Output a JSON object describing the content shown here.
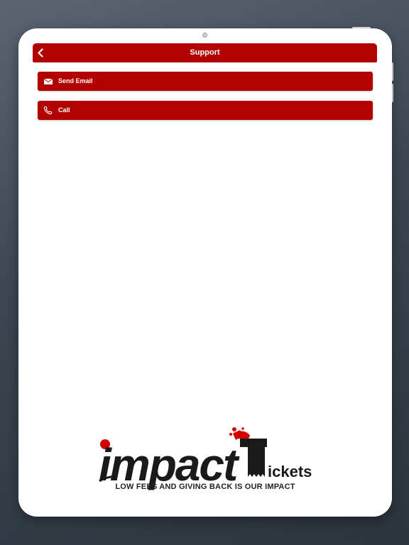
{
  "header": {
    "title": "Support",
    "back_icon": "chevron-left-icon"
  },
  "menu": [
    {
      "label": "Send Email",
      "icon": "mail-icon"
    },
    {
      "label": "Call",
      "icon": "phone-icon"
    }
  ],
  "logo": {
    "text_main": "impact",
    "text_secondary": "ickets",
    "text_letter": "T",
    "tagline": "LOW FEES AND GIVING BACK IS OUR IMPACT"
  },
  "colors": {
    "brand_red": "#b30000",
    "background": "#ffffff",
    "logo_text": "#1a1a1a"
  }
}
